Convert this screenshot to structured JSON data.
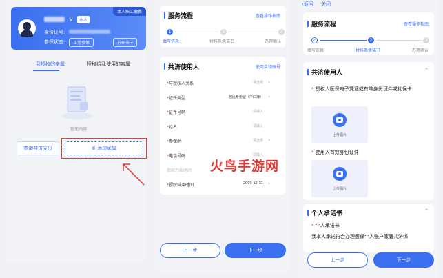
{
  "panel1": {
    "badge": "本人职工缴费",
    "gender_icon": "female-icon",
    "self_tag": "本人",
    "id_label": "身份证号:",
    "status_label": "参保状态:",
    "status_value": "正常参保",
    "city": "苏州市",
    "tabs": [
      "我授权的亲属",
      "授权给我使用的亲属"
    ],
    "empty_text": "暂无内容",
    "query_button": "查询共济支出",
    "add_button": "添加家属"
  },
  "panel2": {
    "service_title": "服务流程",
    "guide_link": "查看操作指南",
    "steps": [
      "填写信息",
      "材料及承诺书",
      "办理确认"
    ],
    "step_numbers": [
      "1",
      "2",
      "3"
    ],
    "form_title": "共济使用人",
    "account_link": "使用余镇账号",
    "rows": [
      {
        "label": "与授权人关系",
        "value": "请选择",
        "required": true
      },
      {
        "label": "证件类型",
        "value": "居民身份证（户口簿）",
        "required": true
      },
      {
        "label": "证件号码",
        "value": "请输入",
        "required": true
      },
      {
        "label": "姓名",
        "value": "请输入",
        "required": true
      },
      {
        "label": "参保地",
        "value": "请选择",
        "required": true
      },
      {
        "label": "电话号码",
        "value": "请输入",
        "required": true
      },
      {
        "label": "授权开始时间",
        "value": "",
        "required": false
      },
      {
        "label": "授权结束时间",
        "value": "2099-12-31",
        "required": true
      }
    ],
    "prev_button": "上一步",
    "next_button": "下一步"
  },
  "watermark": "火鸟手游网",
  "panel3": {
    "back": "返回",
    "close": "关闭",
    "service_title": "服务流程",
    "guide_link": "查看操作指南",
    "steps": [
      "填写信息",
      "材料及承诺书",
      "办理确认"
    ],
    "step_numbers": [
      "✓",
      "2",
      "3"
    ],
    "section1_title": "共济使用人",
    "q1": "授权人医保电子凭证或有效身份证件或社保卡",
    "upload_label": "上传图片",
    "q2": "使用人有效身份证件",
    "section2_title": "个人承诺书",
    "q3": "个人承诺书",
    "promise_text": "我本人承诺符合办理医保个人账户家庭共济绑",
    "prev_button": "上一步",
    "next_button": "下一步"
  },
  "colors": {
    "accent": "#3a6ff0",
    "highlight": "#e53935"
  }
}
